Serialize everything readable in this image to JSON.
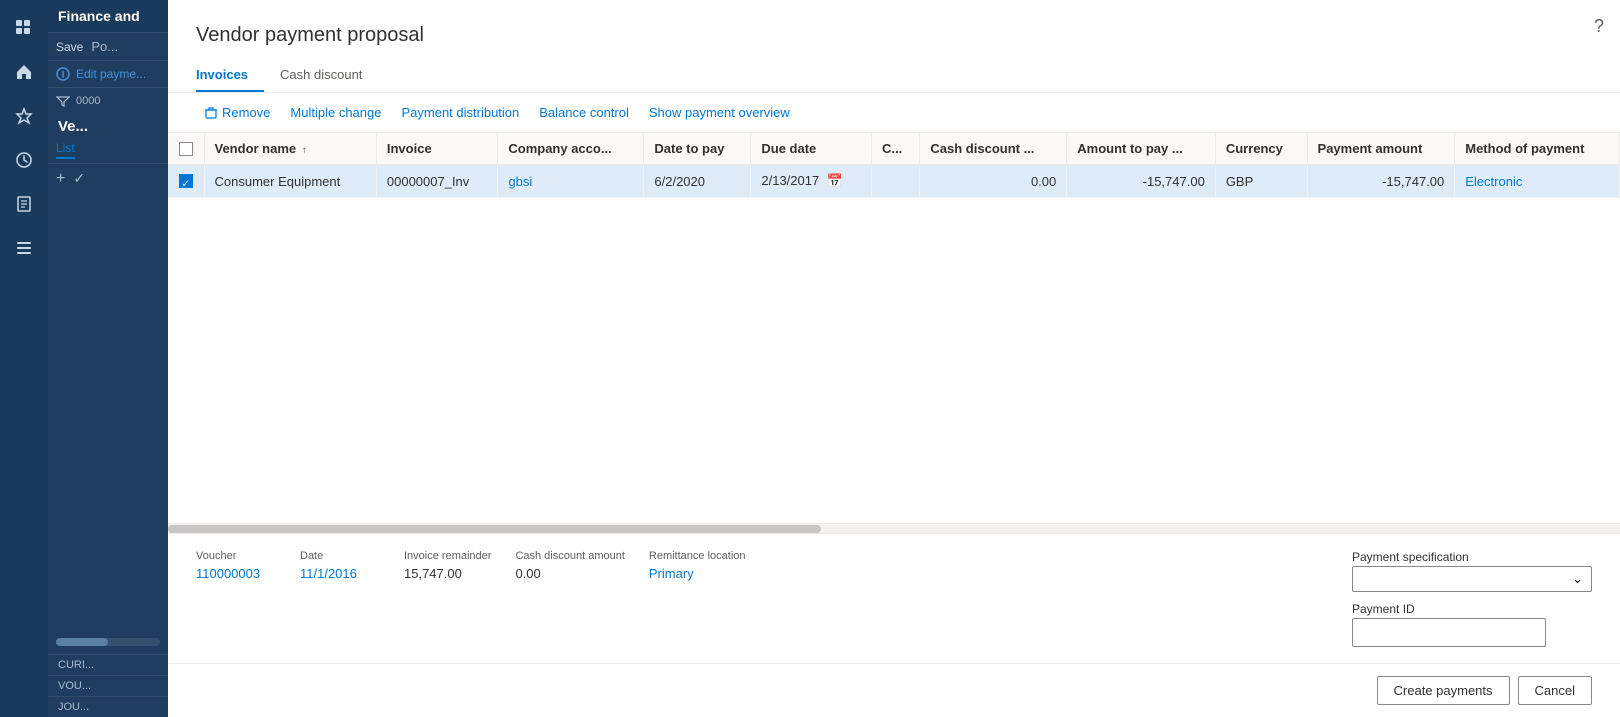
{
  "sidebar": {
    "app_title": "Finance and",
    "nav_icons": [
      "grid",
      "home",
      "star",
      "clock",
      "notes",
      "list"
    ]
  },
  "panel": {
    "save_label": "Save",
    "post_label": "Po...",
    "edit_label": "Edit payme...",
    "filter_tooltip": "Filter",
    "id_prefix": "0000",
    "title": "Ve...",
    "list_tab": "List",
    "add_btn": "+",
    "check_btn": "✓",
    "cur_label": "CURI...",
    "vou_label": "VOU...",
    "jou_label": "JOU..."
  },
  "modal": {
    "title": "Vendor payment proposal",
    "tabs": [
      {
        "id": "invoices",
        "label": "Invoices",
        "active": true
      },
      {
        "id": "cash-discount",
        "label": "Cash discount",
        "active": false
      }
    ],
    "actions": [
      {
        "id": "remove",
        "label": "Remove",
        "icon": "🗑"
      },
      {
        "id": "multiple-change",
        "label": "Multiple change"
      },
      {
        "id": "payment-distribution",
        "label": "Payment distribution"
      },
      {
        "id": "balance-control",
        "label": "Balance control"
      },
      {
        "id": "show-payment-overview",
        "label": "Show payment overview"
      }
    ],
    "table": {
      "columns": [
        {
          "id": "checkbox",
          "label": ""
        },
        {
          "id": "vendor-name",
          "label": "Vendor name",
          "sortable": true
        },
        {
          "id": "invoice",
          "label": "Invoice"
        },
        {
          "id": "company-account",
          "label": "Company acco..."
        },
        {
          "id": "date-to-pay",
          "label": "Date to pay"
        },
        {
          "id": "due-date",
          "label": "Due date"
        },
        {
          "id": "c",
          "label": "C..."
        },
        {
          "id": "cash-discount",
          "label": "Cash discount ..."
        },
        {
          "id": "amount-to-pay",
          "label": "Amount to pay ..."
        },
        {
          "id": "currency",
          "label": "Currency"
        },
        {
          "id": "payment-amount",
          "label": "Payment amount"
        },
        {
          "id": "method-of-payment",
          "label": "Method of payment"
        }
      ],
      "rows": [
        {
          "selected": true,
          "vendor_name": "Consumer Equipment",
          "invoice": "00000007_Inv",
          "company_account": "gbsi",
          "date_to_pay": "6/2/2020",
          "due_date": "2/13/2017",
          "c": "",
          "cash_discount": "0.00",
          "amount_to_pay": "-15,747.00",
          "currency": "GBP",
          "payment_amount": "-15,747.00",
          "method_of_payment": "Electronic"
        }
      ]
    },
    "detail": {
      "voucher_label": "Voucher",
      "voucher_value": "110000003",
      "date_label": "Date",
      "date_value": "11/1/2016",
      "invoice_remainder_label": "Invoice remainder",
      "invoice_remainder_value": "15,747.00",
      "cash_discount_amount_label": "Cash discount amount",
      "cash_discount_amount_value": "0.00",
      "remittance_location_label": "Remittance location",
      "remittance_location_value": "Primary",
      "payment_specification_label": "Payment specification",
      "payment_specification_value": "",
      "payment_id_label": "Payment ID",
      "payment_id_value": ""
    },
    "footer": {
      "create_payments_label": "Create payments",
      "cancel_label": "Cancel"
    }
  }
}
